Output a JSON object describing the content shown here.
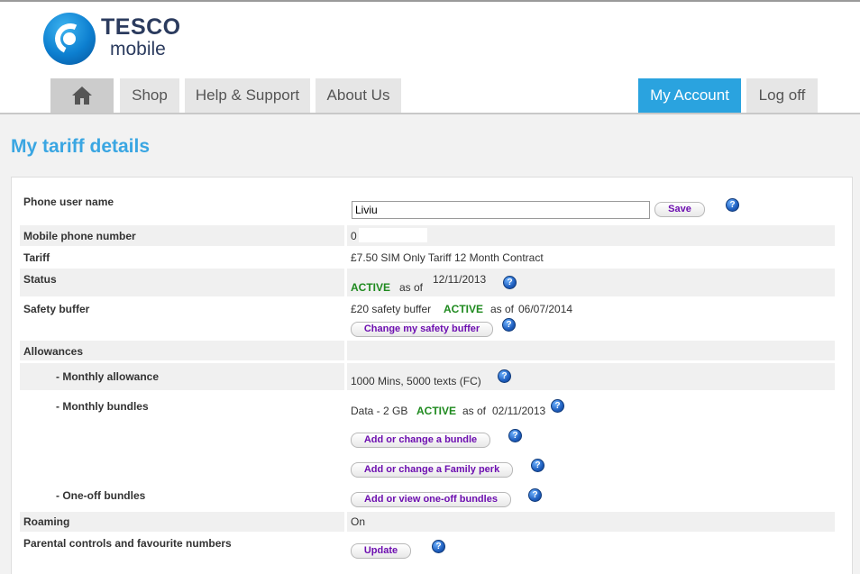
{
  "logo": {
    "brand": "TESCO",
    "sub": "mobile"
  },
  "nav": {
    "home_icon": "home-icon",
    "shop": "Shop",
    "help": "Help & Support",
    "about": "About Us",
    "account": "My Account",
    "logoff": "Log off"
  },
  "colors": {
    "accent": "#2aa3df",
    "active_status": "#1f8a1f",
    "button_text": "#6d0fb0"
  },
  "page": {
    "title": "My tariff details"
  },
  "rows": {
    "phone_user_name": {
      "label": "Phone user name",
      "input_value": "Liviu",
      "save": "Save"
    },
    "mobile_number": {
      "label": "Mobile phone number",
      "value": "0"
    },
    "tariff": {
      "label": "Tariff",
      "value": "£7.50 SIM Only Tariff 12 Month Contract"
    },
    "status": {
      "label": "Status",
      "state": "ACTIVE",
      "as_of": "as of",
      "date": "12/11/2013"
    },
    "safety_buffer": {
      "label": "Safety buffer",
      "value": "£20 safety buffer",
      "state": "ACTIVE",
      "as_of": "as of",
      "date": "06/07/2014",
      "button": "Change my safety buffer"
    },
    "allowances": {
      "label": "Allowances"
    },
    "monthly_allowance": {
      "label": "-  Monthly allowance",
      "value": "1000 Mins, 5000 texts (FC)"
    },
    "monthly_bundles": {
      "label": "-  Monthly bundles",
      "value": "Data - 2 GB",
      "state": "ACTIVE",
      "as_of": "as of",
      "date": "02/11/2013",
      "button_bundle": "Add or change a bundle",
      "button_family": "Add or change a Family perk"
    },
    "one_off_bundles": {
      "label": "-  One-off bundles",
      "button": "Add or view one-off bundles"
    },
    "roaming": {
      "label": "Roaming",
      "value": "On"
    },
    "parental": {
      "label": "Parental controls and favourite numbers",
      "button": "Update"
    }
  },
  "help_icon": "?"
}
